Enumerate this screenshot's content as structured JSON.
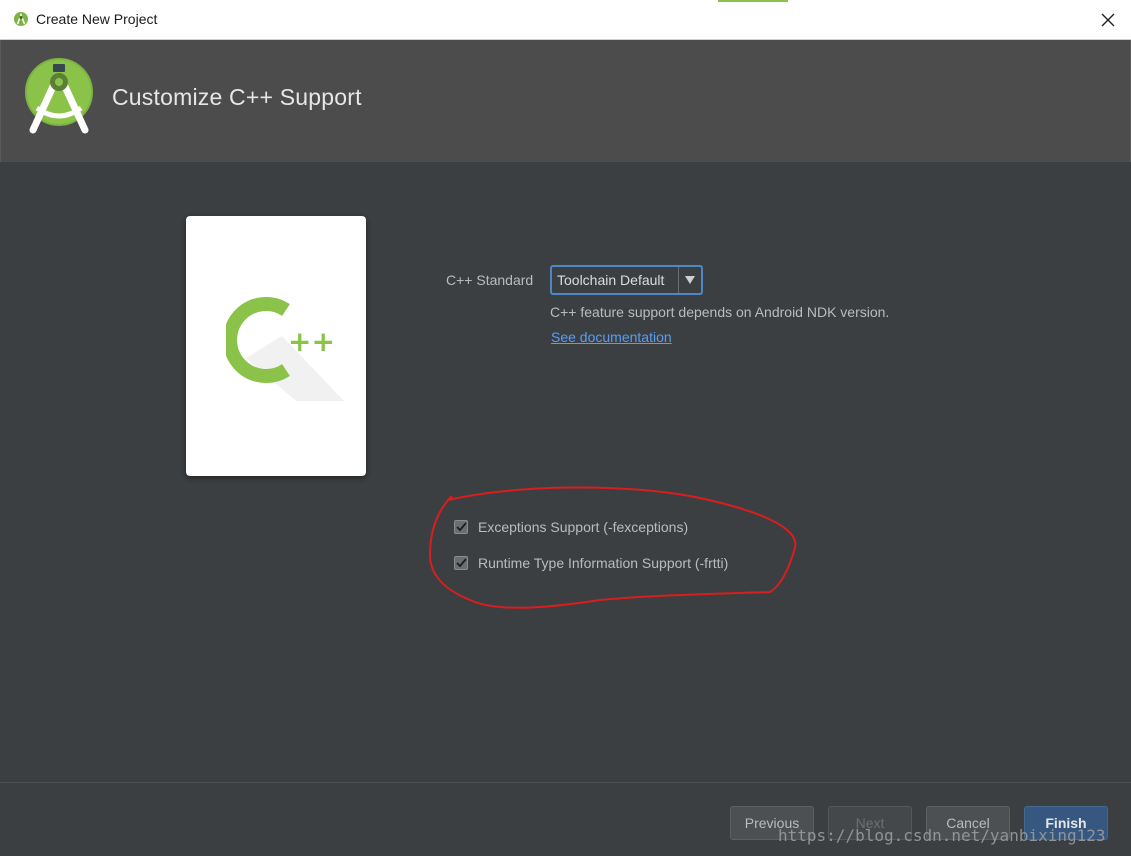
{
  "window": {
    "title": "Create New Project"
  },
  "header": {
    "title": "Customize C++ Support"
  },
  "form": {
    "cpp_standard_label": "C++ Standard",
    "cpp_standard_value": "Toolchain Default",
    "note": "C++ feature support depends on Android NDK version.",
    "doc_link": "See documentation"
  },
  "options": [
    {
      "label": "Exceptions Support (-fexceptions)",
      "checked": true
    },
    {
      "label": "Runtime Type Information Support (-frtti)",
      "checked": true
    }
  ],
  "buttons": {
    "previous": "Previous",
    "next": "Next",
    "cancel": "Cancel",
    "finish": "Finish"
  },
  "watermark": "https://blog.csdn.net/yanbixing123",
  "colors": {
    "background": "#3c3f41",
    "header": "#4c4c4c",
    "accent_green": "#8bc34a",
    "link": "#589df6",
    "primary_button": "#365880",
    "annotation_red": "#d81e1e"
  },
  "icons": {
    "app": "android-studio-icon",
    "close": "close-icon",
    "dropdown": "chevron-down-icon",
    "check": "checkmark-icon"
  }
}
